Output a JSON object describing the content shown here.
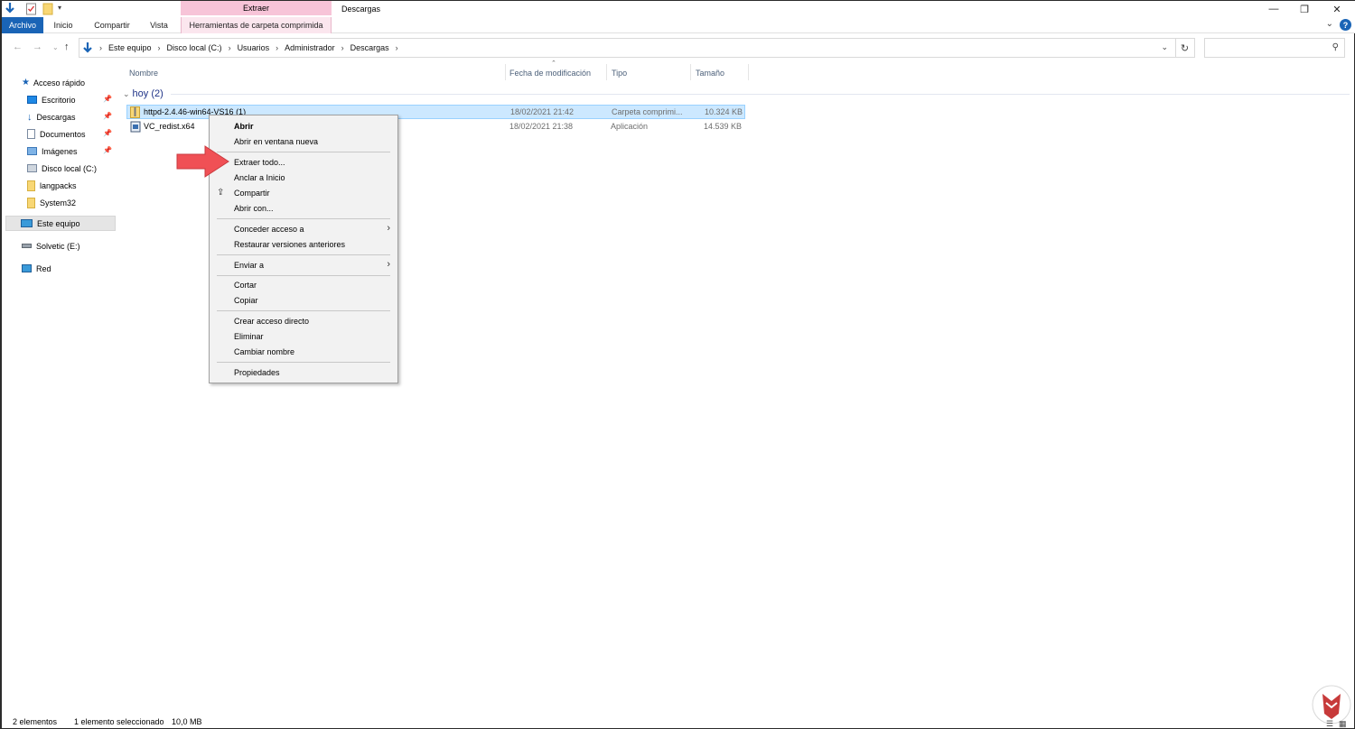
{
  "window": {
    "title": "Descargas",
    "controls": {
      "minimize": "—",
      "maximize": "❐",
      "close": "✕"
    }
  },
  "ribbon": {
    "context_header": "Extraer",
    "tabs": [
      {
        "label": "Archivo"
      },
      {
        "label": "Inicio"
      },
      {
        "label": "Compartir"
      },
      {
        "label": "Vista"
      },
      {
        "label": "Herramientas de carpeta comprimida"
      }
    ]
  },
  "address": {
    "crumbs": [
      "Este equipo",
      "Disco local (C:)",
      "Usuarios",
      "Administrador",
      "Descargas"
    ],
    "separator": "›",
    "search_placeholder": ""
  },
  "sidebar": {
    "items": [
      {
        "label": "Acceso rápido",
        "icon": "star-icon",
        "pinned": false
      },
      {
        "label": "Escritorio",
        "icon": "desktop-icon",
        "pinned": true
      },
      {
        "label": "Descargas",
        "icon": "download-icon",
        "pinned": true
      },
      {
        "label": "Documentos",
        "icon": "documents-icon",
        "pinned": true
      },
      {
        "label": "Imágenes",
        "icon": "pictures-icon",
        "pinned": true
      },
      {
        "label": "Disco local (C:)",
        "icon": "drive-icon",
        "pinned": false
      },
      {
        "label": "langpacks",
        "icon": "folder-icon",
        "pinned": false
      },
      {
        "label": "System32",
        "icon": "folder-icon",
        "pinned": false
      },
      {
        "label": "Este equipo",
        "icon": "computer-icon",
        "pinned": false,
        "selected": true
      },
      {
        "label": "Solvetic (E:)",
        "icon": "usb-drive-icon",
        "pinned": false
      },
      {
        "label": "Red",
        "icon": "network-icon",
        "pinned": false
      }
    ]
  },
  "columns": [
    "Nombre",
    "Fecha de modificación",
    "Tipo",
    "Tamaño"
  ],
  "group": {
    "label": "hoy (2)"
  },
  "files": [
    {
      "name": "httpd-2.4.46-win64-VS16 (1)",
      "date": "18/02/2021 21:42",
      "type": "Carpeta comprimi...",
      "size": "10.324 KB",
      "selected": true
    },
    {
      "name": "VC_redist.x64",
      "date": "18/02/2021 21:38",
      "type": "Aplicación",
      "size": "14.539 KB",
      "selected": false
    }
  ],
  "context_menu": {
    "items": [
      {
        "label": "Abrir",
        "bold": true
      },
      {
        "label": "Abrir en ventana nueva"
      },
      {
        "label": "Extraer todo..."
      },
      {
        "label": "Anclar a Inicio"
      },
      {
        "label": "Compartir",
        "icon": "share-icon"
      },
      {
        "label": "Abrir con..."
      },
      {
        "label": "Conceder acceso a",
        "submenu": true
      },
      {
        "label": "Restaurar versiones anteriores"
      },
      {
        "label": "Enviar a",
        "submenu": true
      },
      {
        "label": "Cortar"
      },
      {
        "label": "Copiar"
      },
      {
        "label": "Crear acceso directo"
      },
      {
        "label": "Eliminar"
      },
      {
        "label": "Cambiar nombre"
      },
      {
        "label": "Propiedades"
      }
    ]
  },
  "status": {
    "count": "2 elementos",
    "selection": "1 elemento seleccionado",
    "size": "10,0 MB"
  },
  "colors": {
    "file_tab": "#1a64b6",
    "context_tab": "#f7c4d8",
    "selection": "#cce8ff",
    "arrow": "#f05055"
  }
}
